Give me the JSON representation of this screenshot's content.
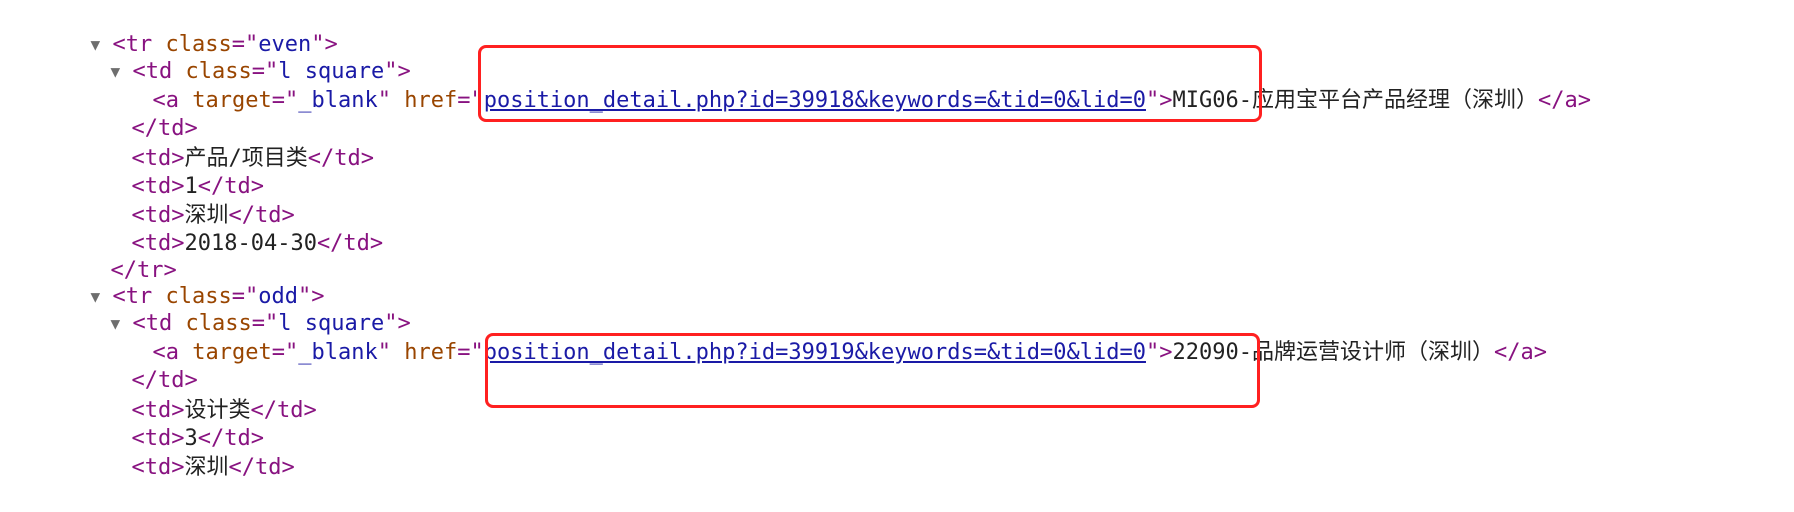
{
  "expand_glyph": "▼",
  "rows": [
    {
      "tr_open": {
        "lt": "<",
        "tag": "tr",
        "attr": "class",
        "eq": "=\"",
        "val": "even",
        "close": "\">"
      },
      "td_link_open": {
        "lt": "<",
        "tag": "td",
        "attr": "class",
        "eq": "=\"",
        "val": "l square",
        "close": "\">"
      },
      "anchor": {
        "lt": "<",
        "tag": "a",
        "attr1": "target",
        "eq1": "=\"",
        "val1": "_blank",
        "q1": "\"",
        "attr2": "href",
        "eq2": "=\"",
        "href": "position_detail.php?id=39918&keywords=&tid=0&lid=0",
        "gt": "\">",
        "text": "MIG06-应用宝平台产品经理（深圳）",
        "close": "</a>"
      },
      "td_close": "</td>",
      "cells": [
        "产品/项目类",
        "1",
        "深圳",
        "2018-04-30"
      ],
      "tr_close": "</tr>"
    },
    {
      "tr_open": {
        "lt": "<",
        "tag": "tr",
        "attr": "class",
        "eq": "=\"",
        "val": "odd",
        "close": "\">"
      },
      "td_link_open": {
        "lt": "<",
        "tag": "td",
        "attr": "class",
        "eq": "=\"",
        "val": "l square",
        "close": "\">"
      },
      "anchor": {
        "lt": "<",
        "tag": "a",
        "attr1": "target",
        "eq1": "=\"",
        "val1": "_blank",
        "q1": "\"",
        "attr2": "href",
        "eq2": "=\"",
        "href": "position_detail.php?id=39919&keywords=&tid=0&lid=0",
        "gt": "\">",
        "text": "22090-品牌运营设计师（深圳）",
        "close": "</a>"
      },
      "td_close": "</td>",
      "cells": [
        "设计类",
        "3",
        "深圳"
      ]
    }
  ],
  "td_tag": {
    "open": "<td>",
    "close": "</td>"
  },
  "highlight_color": "#ff2020"
}
